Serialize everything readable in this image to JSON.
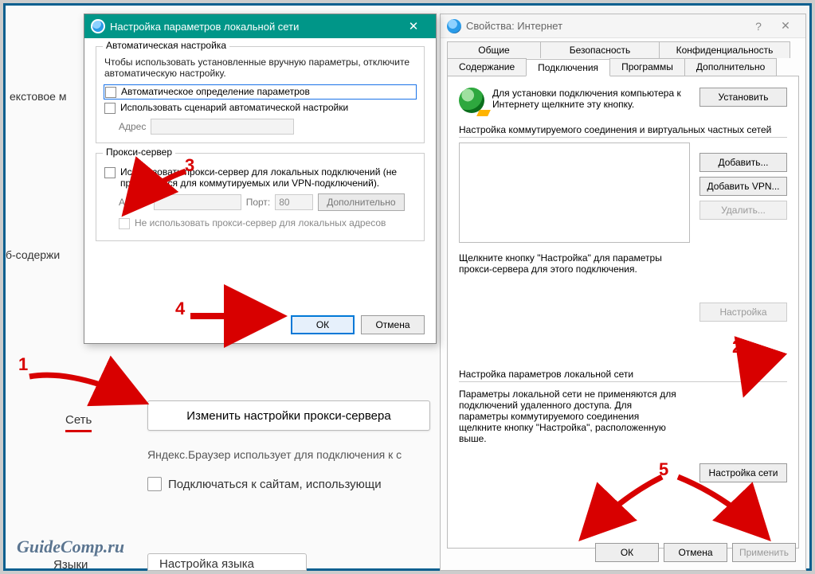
{
  "bg": {
    "row1": "екстовое м",
    "row2": "б-содержи",
    "net_label": "Сеть",
    "proxy_btn": "Изменить настройки прокси-сервера",
    "note": "Яндекс.Браузер использует для подключения к с",
    "https": "Подключаться к сайтам, использующи",
    "lang_label": "Языки",
    "lang_btn": "Настройка языка"
  },
  "dlg1": {
    "title": "Настройка параметров локальной сети",
    "auto_legend": "Автоматическая настройка",
    "auto_text": "Чтобы использовать установленные вручную параметры, отключите автоматическую настройку.",
    "auto_detect": "Автоматическое определение параметров",
    "use_script": "Использовать сценарий автоматической настройки",
    "addr_label": "Адрес",
    "proxy_legend": "Прокси-сервер",
    "use_proxy": "Использовать прокси-сервер для локальных подключений (не применяется для коммутируемых или VPN-подключений).",
    "addr2_label": "Адрес:",
    "port_label": "Порт:",
    "port_value": "80",
    "advanced": "Дополнительно",
    "bypass_local": "Не использовать прокси-сервер для локальных адресов",
    "ok": "ОК",
    "cancel": "Отмена"
  },
  "dlg2": {
    "title": "Свойства: Интернет",
    "tabs": {
      "general": "Общие",
      "security": "Безопасность",
      "privacy": "Конфиденциальность",
      "content": "Содержание",
      "connections": "Подключения",
      "programs": "Программы",
      "advanced": "Дополнительно"
    },
    "install_text": "Для установки подключения компьютера к Интернету щелкните эту кнопку.",
    "install_btn": "Установить",
    "dial_hdr": "Настройка коммутируемого соединения и виртуальных частных сетей",
    "add_btn": "Добавить...",
    "add_vpn_btn": "Добавить VPN...",
    "remove_btn": "Удалить...",
    "settings_btn": "Настройка",
    "proxy_hint": "Щелкните кнопку \"Настройка\" для параметры прокси-сервера для этого подключения.",
    "lan_hdr": "Настройка параметров локальной сети",
    "lan_note": "Параметры локальной сети не применяются для подключений удаленного доступа. Для параметры коммутируемого соединения щелкните кнопку \"Настройка\", расположенную выше.",
    "lan_btn": "Настройка сети",
    "ok": "ОК",
    "cancel": "Отмена",
    "apply": "Применить"
  },
  "annot": {
    "n1": "1",
    "n2": "2",
    "n3": "3",
    "n4": "4",
    "n5": "5"
  },
  "watermark": "GuideComp.ru"
}
